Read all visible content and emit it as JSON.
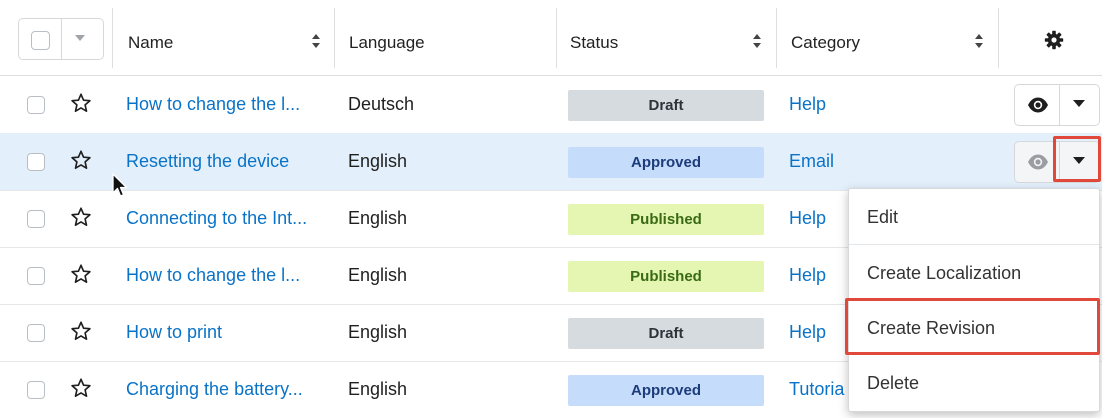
{
  "header": {
    "name_label": "Name",
    "language_label": "Language",
    "status_label": "Status",
    "category_label": "Category"
  },
  "rows": [
    {
      "name": "How to change the l...",
      "language": "Deutsch",
      "status": "Draft",
      "category": "Help"
    },
    {
      "name": "Resetting the device",
      "language": "English",
      "status": "Approved",
      "category": "Email"
    },
    {
      "name": "Connecting to the Int...",
      "language": "English",
      "status": "Published",
      "category": "Help"
    },
    {
      "name": "How to change the l...",
      "language": "English",
      "status": "Published",
      "category": "Help"
    },
    {
      "name": "How to print",
      "language": "English",
      "status": "Draft",
      "category": "Help"
    },
    {
      "name": "Charging the battery...",
      "language": "English",
      "status": "Approved",
      "category": "Tutoria"
    }
  ],
  "menu": {
    "items": [
      "Edit",
      "Create Localization",
      "Create Revision",
      "Delete"
    ]
  },
  "colors": {
    "link": "#0a73c7",
    "highlight": "#e0483b",
    "selected_row": "#e3f0fb",
    "draft": "#d6dbe0",
    "approved": "#c6dcfb",
    "published": "#e4f6b2"
  },
  "icons": [
    "checkbox-icon",
    "caret-down-icon",
    "sort-icon",
    "gear-icon",
    "star-icon",
    "eye-icon",
    "mouse-pointer-icon"
  ]
}
